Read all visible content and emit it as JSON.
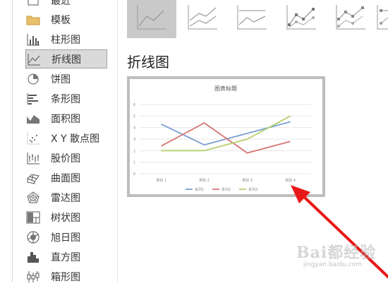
{
  "sidebar": {
    "items": [
      {
        "label": "最近",
        "icon": "recent-icon"
      },
      {
        "label": "模板",
        "icon": "folder-icon"
      },
      {
        "label": "柱形图",
        "icon": "column-chart-icon"
      },
      {
        "label": "折线图",
        "icon": "line-chart-icon",
        "selected": true
      },
      {
        "label": "饼图",
        "icon": "pie-chart-icon"
      },
      {
        "label": "条形图",
        "icon": "bar-chart-icon"
      },
      {
        "label": "面积图",
        "icon": "area-chart-icon"
      },
      {
        "label": "X Y 散点图",
        "icon": "scatter-chart-icon"
      },
      {
        "label": "股价图",
        "icon": "stock-chart-icon"
      },
      {
        "label": "曲面图",
        "icon": "surface-chart-icon"
      },
      {
        "label": "雷达图",
        "icon": "radar-chart-icon"
      },
      {
        "label": "树状图",
        "icon": "treemap-chart-icon"
      },
      {
        "label": "旭日图",
        "icon": "sunburst-chart-icon"
      },
      {
        "label": "直方图",
        "icon": "histogram-chart-icon"
      },
      {
        "label": "箱形图",
        "icon": "boxplot-chart-icon"
      }
    ]
  },
  "subtypes": [
    {
      "icon": "line-subtype-icon",
      "selected": true
    },
    {
      "icon": "stacked-line-subtype-icon"
    },
    {
      "icon": "percent-stacked-line-subtype-icon"
    },
    {
      "icon": "line-markers-subtype-icon"
    },
    {
      "icon": "stacked-line-markers-subtype-icon"
    },
    {
      "icon": "percent-stacked-line-markers-subtype-icon"
    }
  ],
  "main": {
    "title": "折线图"
  },
  "chart_data": {
    "type": "line",
    "title": "图表标题",
    "categories": [
      "类别 1",
      "类别 2",
      "类别 3",
      "类别 4"
    ],
    "series": [
      {
        "name": "系列1",
        "values": [
          4.3,
          2.5,
          3.5,
          4.5
        ],
        "color": "#7a9fd4"
      },
      {
        "name": "系列2",
        "values": [
          2.4,
          4.4,
          1.8,
          2.8
        ],
        "color": "#d87474"
      },
      {
        "name": "系列3",
        "values": [
          2,
          2,
          3,
          5
        ],
        "color": "#b5cf6b"
      }
    ],
    "yticks": [
      "0",
      "1",
      "2",
      "3",
      "4",
      "5",
      "6"
    ],
    "ylim": [
      0,
      6
    ],
    "grid": true,
    "legend": "bottom"
  },
  "watermark": {
    "text": "Bai都经验",
    "sub": "jingyan.baidu.com"
  }
}
